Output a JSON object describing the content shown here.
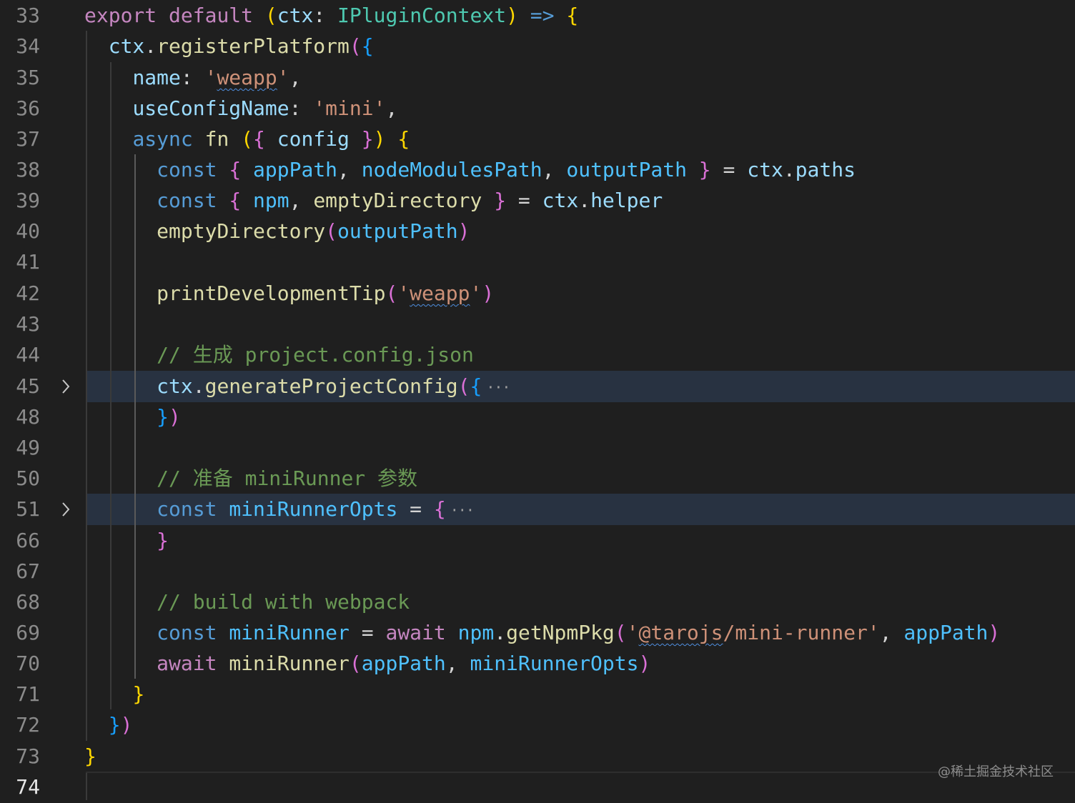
{
  "editor": {
    "lines": [
      {
        "num": "33",
        "tokens": [
          {
            "t": "export",
            "c": "#c586c0"
          },
          {
            "t": " "
          },
          {
            "t": "default",
            "c": "#c586c0"
          },
          {
            "t": " "
          },
          {
            "t": "(",
            "c": "#ffd700"
          },
          {
            "t": "ctx",
            "c": "#9cdcfe"
          },
          {
            "t": ": "
          },
          {
            "t": "IPluginContext",
            "c": "#4ec9b0"
          },
          {
            "t": ")",
            "c": "#ffd700"
          },
          {
            "t": " "
          },
          {
            "t": "=>",
            "c": "#569cd6"
          },
          {
            "t": " "
          },
          {
            "t": "{",
            "c": "#ffd700"
          }
        ]
      },
      {
        "num": "34",
        "tokens": [
          {
            "t": "  "
          },
          {
            "t": "ctx",
            "c": "#9cdcfe"
          },
          {
            "t": "."
          },
          {
            "t": "registerPlatform",
            "c": "#dcdcaa"
          },
          {
            "t": "(",
            "c": "#da70d6"
          },
          {
            "t": "{",
            "c": "#179fff"
          }
        ]
      },
      {
        "num": "35",
        "tokens": [
          {
            "t": "    "
          },
          {
            "t": "name",
            "c": "#9cdcfe"
          },
          {
            "t": ": "
          },
          {
            "t": "'",
            "c": "#ce9178"
          },
          {
            "t": "weapp",
            "c": "#ce9178",
            "sq": true
          },
          {
            "t": "'",
            "c": "#ce9178"
          },
          {
            "t": ","
          }
        ]
      },
      {
        "num": "36",
        "tokens": [
          {
            "t": "    "
          },
          {
            "t": "useConfigName",
            "c": "#9cdcfe"
          },
          {
            "t": ": "
          },
          {
            "t": "'mini'",
            "c": "#ce9178"
          },
          {
            "t": ","
          }
        ]
      },
      {
        "num": "37",
        "tokens": [
          {
            "t": "    "
          },
          {
            "t": "async",
            "c": "#569cd6"
          },
          {
            "t": " "
          },
          {
            "t": "fn",
            "c": "#dcdcaa"
          },
          {
            "t": " "
          },
          {
            "t": "(",
            "c": "#ffd700"
          },
          {
            "t": "{",
            "c": "#da70d6"
          },
          {
            "t": " "
          },
          {
            "t": "config",
            "c": "#9cdcfe"
          },
          {
            "t": " "
          },
          {
            "t": "}",
            "c": "#da70d6"
          },
          {
            "t": ")",
            "c": "#ffd700"
          },
          {
            "t": " "
          },
          {
            "t": "{",
            "c": "#ffd700"
          }
        ]
      },
      {
        "num": "38",
        "tokens": [
          {
            "t": "      "
          },
          {
            "t": "const",
            "c": "#569cd6"
          },
          {
            "t": " "
          },
          {
            "t": "{",
            "c": "#da70d6"
          },
          {
            "t": " "
          },
          {
            "t": "appPath",
            "c": "#4fc1ff"
          },
          {
            "t": ", "
          },
          {
            "t": "nodeModulesPath",
            "c": "#4fc1ff"
          },
          {
            "t": ", "
          },
          {
            "t": "outputPath",
            "c": "#4fc1ff"
          },
          {
            "t": " "
          },
          {
            "t": "}",
            "c": "#da70d6"
          },
          {
            "t": " = "
          },
          {
            "t": "ctx",
            "c": "#9cdcfe"
          },
          {
            "t": "."
          },
          {
            "t": "paths",
            "c": "#9cdcfe"
          }
        ]
      },
      {
        "num": "39",
        "tokens": [
          {
            "t": "      "
          },
          {
            "t": "const",
            "c": "#569cd6"
          },
          {
            "t": " "
          },
          {
            "t": "{",
            "c": "#da70d6"
          },
          {
            "t": " "
          },
          {
            "t": "npm",
            "c": "#4fc1ff"
          },
          {
            "t": ", "
          },
          {
            "t": "emptyDirectory",
            "c": "#dcdcaa"
          },
          {
            "t": " "
          },
          {
            "t": "}",
            "c": "#da70d6"
          },
          {
            "t": " = "
          },
          {
            "t": "ctx",
            "c": "#9cdcfe"
          },
          {
            "t": "."
          },
          {
            "t": "helper",
            "c": "#9cdcfe"
          }
        ]
      },
      {
        "num": "40",
        "tokens": [
          {
            "t": "      "
          },
          {
            "t": "emptyDirectory",
            "c": "#dcdcaa"
          },
          {
            "t": "(",
            "c": "#da70d6"
          },
          {
            "t": "outputPath",
            "c": "#4fc1ff"
          },
          {
            "t": ")",
            "c": "#da70d6"
          }
        ]
      },
      {
        "num": "41",
        "tokens": []
      },
      {
        "num": "42",
        "tokens": [
          {
            "t": "      "
          },
          {
            "t": "printDevelopmentTip",
            "c": "#dcdcaa"
          },
          {
            "t": "(",
            "c": "#da70d6"
          },
          {
            "t": "'",
            "c": "#ce9178"
          },
          {
            "t": "weapp",
            "c": "#ce9178",
            "sq": true
          },
          {
            "t": "'",
            "c": "#ce9178"
          },
          {
            "t": ")",
            "c": "#da70d6"
          }
        ]
      },
      {
        "num": "43",
        "tokens": []
      },
      {
        "num": "44",
        "tokens": [
          {
            "t": "      "
          },
          {
            "t": "// 生成 project.config.json",
            "c": "#6a9955"
          }
        ]
      },
      {
        "num": "45",
        "fold": true,
        "highlight": true,
        "tokens": [
          {
            "t": "      "
          },
          {
            "t": "ctx",
            "c": "#9cdcfe"
          },
          {
            "t": "."
          },
          {
            "t": "generateProjectConfig",
            "c": "#dcdcaa"
          },
          {
            "t": "(",
            "c": "#da70d6"
          },
          {
            "t": "{",
            "c": "#179fff"
          }
        ],
        "ellipsis": "···"
      },
      {
        "num": "48",
        "tokens": [
          {
            "t": "      "
          },
          {
            "t": "}",
            "c": "#179fff"
          },
          {
            "t": ")",
            "c": "#da70d6"
          }
        ]
      },
      {
        "num": "49",
        "tokens": []
      },
      {
        "num": "50",
        "tokens": [
          {
            "t": "      "
          },
          {
            "t": "// 准备 miniRunner 参数",
            "c": "#6a9955"
          }
        ]
      },
      {
        "num": "51",
        "fold": true,
        "highlight": true,
        "tokens": [
          {
            "t": "      "
          },
          {
            "t": "const",
            "c": "#569cd6"
          },
          {
            "t": " "
          },
          {
            "t": "miniRunnerOpts",
            "c": "#4fc1ff"
          },
          {
            "t": " = "
          },
          {
            "t": "{",
            "c": "#da70d6"
          }
        ],
        "ellipsis": "···"
      },
      {
        "num": "66",
        "tokens": [
          {
            "t": "      "
          },
          {
            "t": "}",
            "c": "#da70d6"
          }
        ]
      },
      {
        "num": "67",
        "tokens": []
      },
      {
        "num": "68",
        "tokens": [
          {
            "t": "      "
          },
          {
            "t": "// build with webpack",
            "c": "#6a9955"
          }
        ]
      },
      {
        "num": "69",
        "tokens": [
          {
            "t": "      "
          },
          {
            "t": "const",
            "c": "#569cd6"
          },
          {
            "t": " "
          },
          {
            "t": "miniRunner",
            "c": "#4fc1ff"
          },
          {
            "t": " = "
          },
          {
            "t": "await",
            "c": "#c586c0"
          },
          {
            "t": " "
          },
          {
            "t": "npm",
            "c": "#4fc1ff"
          },
          {
            "t": "."
          },
          {
            "t": "getNpmPkg",
            "c": "#dcdcaa"
          },
          {
            "t": "(",
            "c": "#da70d6"
          },
          {
            "t": "'",
            "c": "#ce9178"
          },
          {
            "t": "@tarojs",
            "c": "#ce9178",
            "sq": true
          },
          {
            "t": "/mini-runner'",
            "c": "#ce9178"
          },
          {
            "t": ", "
          },
          {
            "t": "appPath",
            "c": "#4fc1ff"
          },
          {
            "t": ")",
            "c": "#da70d6"
          }
        ]
      },
      {
        "num": "70",
        "tokens": [
          {
            "t": "      "
          },
          {
            "t": "await",
            "c": "#c586c0"
          },
          {
            "t": " "
          },
          {
            "t": "miniRunner",
            "c": "#dcdcaa"
          },
          {
            "t": "(",
            "c": "#da70d6"
          },
          {
            "t": "appPath",
            "c": "#4fc1ff"
          },
          {
            "t": ", "
          },
          {
            "t": "miniRunnerOpts",
            "c": "#4fc1ff"
          },
          {
            "t": ")",
            "c": "#da70d6"
          }
        ]
      },
      {
        "num": "71",
        "tokens": [
          {
            "t": "    "
          },
          {
            "t": "}",
            "c": "#ffd700"
          }
        ]
      },
      {
        "num": "72",
        "tokens": [
          {
            "t": "  "
          },
          {
            "t": "}",
            "c": "#179fff"
          },
          {
            "t": ")",
            "c": "#da70d6"
          }
        ]
      },
      {
        "num": "73",
        "tokens": [
          {
            "t": "}",
            "c": "#ffd700"
          }
        ]
      },
      {
        "num": "74",
        "active": true,
        "tokens": []
      }
    ]
  },
  "watermark": "@稀土掘金技术社区"
}
